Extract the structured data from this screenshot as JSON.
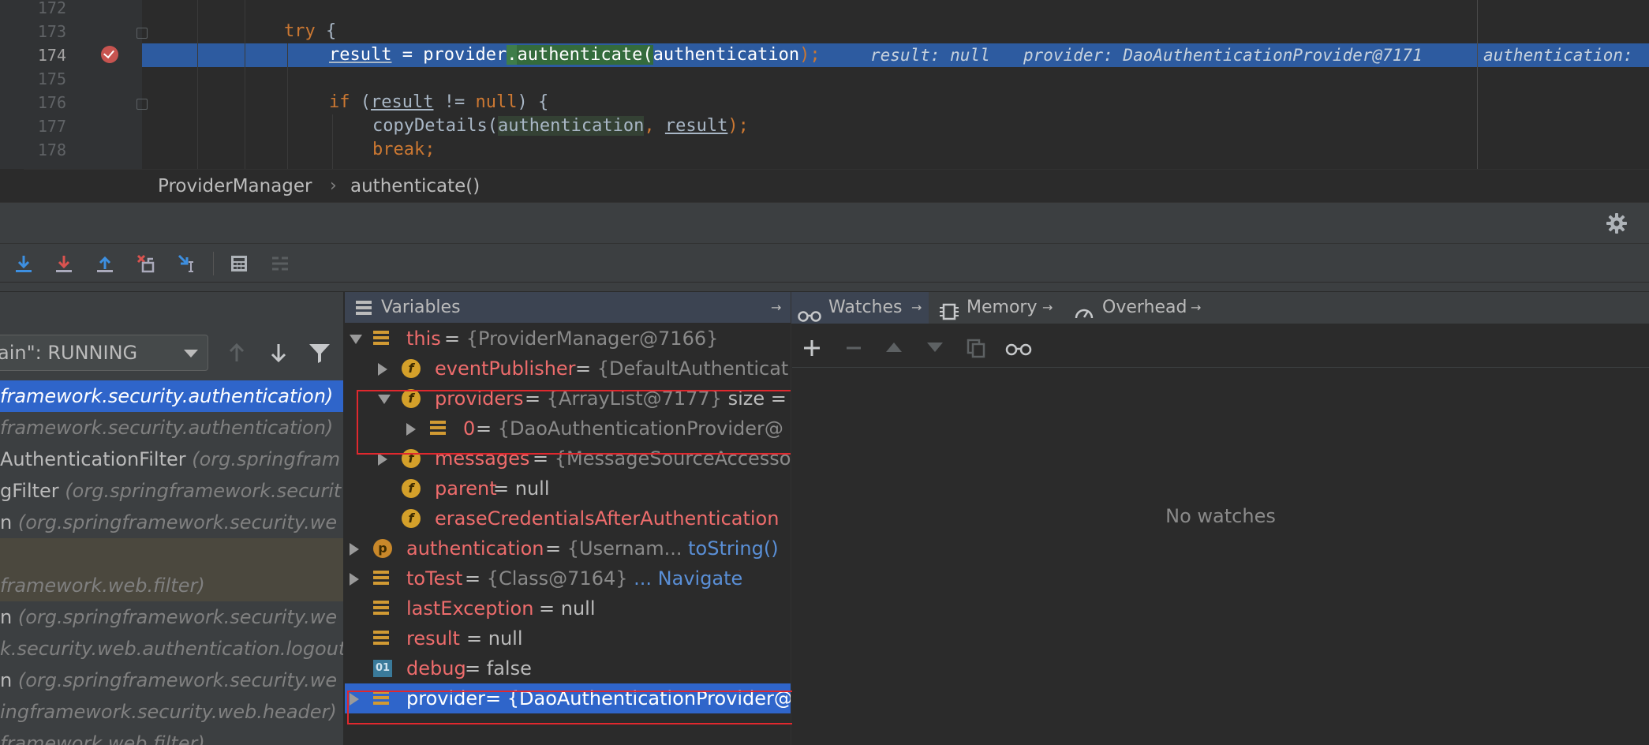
{
  "editor": {
    "lines": [
      {
        "num": "172"
      },
      {
        "num": "173",
        "kw_try": "try",
        "brace": " {"
      },
      {
        "num": "174",
        "result": "result",
        "assign": " = ",
        "provider": "provider",
        "dot": ".",
        "method": "authenticate",
        "open": "(",
        "arg": "authentication",
        "close": ");",
        "inlay1": "result: null",
        "inlay2": "provider: DaoAuthenticationProvider@7171",
        "inlay3": "authentication: "
      },
      {
        "num": "175"
      },
      {
        "num": "176",
        "kw_if": "if",
        "open": " (",
        "result": "result",
        "ne": " != ",
        "kw_null": "null",
        "close": ") {"
      },
      {
        "num": "177",
        "method": "copyDetails(",
        "arg1": "authentication",
        "comma": ", ",
        "arg2": "result",
        "close": ");"
      },
      {
        "num": "178",
        "kw_break": "break",
        "semi": ";"
      }
    ]
  },
  "breadcrumb": {
    "class_name": "ProviderManager",
    "separator": "›",
    "method_name": "authenticate()"
  },
  "thread_selector": {
    "value": "ain\": RUNNING"
  },
  "frames": [
    {
      "m": "",
      "pkg": "framework.security.authentication)",
      "selected": true
    },
    {
      "m": "",
      "pkg": "framework.security.authentication)"
    },
    {
      "m": "AuthenticationFilter ",
      "pkg": "(org.springfram"
    },
    {
      "m": "gFilter ",
      "pkg": "(org.springframework.securit"
    },
    {
      "m": "n ",
      "pkg": "(org.springframework.security.we"
    },
    {
      "m": "",
      "pkg": "",
      "lib": true
    },
    {
      "m": "",
      "pkg": "framework.web.filter)",
      "lib": true
    },
    {
      "m": "n ",
      "pkg": "(org.springframework.security.we"
    },
    {
      "m": "",
      "pkg": "k.security.web.authentication.logout"
    },
    {
      "m": "n ",
      "pkg": "(org.springframework.security.we"
    },
    {
      "m": "",
      "pkg": "ingframework.security.web.header)"
    },
    {
      "m": "",
      "pkg": "framework.web.filter)"
    }
  ],
  "variables": {
    "title": "Variables",
    "rows": [
      {
        "name": "this",
        "rest": " = ",
        "value": "{ProviderManager@7166}"
      },
      {
        "name": "eventPublisher",
        "rest": " = ",
        "value": "{DefaultAuthenticat"
      },
      {
        "name": "providers",
        "rest": " = ",
        "value": "{ArrayList@7177}",
        "extra": "  size = "
      },
      {
        "name": "0",
        "rest": " = ",
        "value": "{DaoAuthenticationProvider@"
      },
      {
        "name": "messages",
        "rest": " = ",
        "value": "{MessageSourceAccesso"
      },
      {
        "name": "parent",
        "rest": " = null"
      },
      {
        "name": "eraseCredentialsAfterAuthentication",
        "rest": ""
      },
      {
        "name": "authentication",
        "rest": " = ",
        "value": "{Usernam... ",
        "link": "toString()"
      },
      {
        "name": "toTest",
        "rest": " = ",
        "value": "{Class@7164}",
        "link": " ... Navigate"
      },
      {
        "name": "lastException",
        "rest": " = null"
      },
      {
        "name": "result",
        "rest": " = null"
      },
      {
        "name": "debug",
        "rest": " = false"
      },
      {
        "name": "provider",
        "rest": " = ",
        "value": "{DaoAuthenticationProvider@"
      }
    ]
  },
  "tabs": {
    "watches": "Watches",
    "memory": "Memory",
    "overhead": "Overhead",
    "pin": "→"
  },
  "watches": {
    "empty_text": "No watches"
  },
  "colors": {
    "selection": "#2f65ca",
    "highlight_line": "#2d5ba0",
    "annotation_box": "#e0282e",
    "breakpoint": "#c75450"
  }
}
